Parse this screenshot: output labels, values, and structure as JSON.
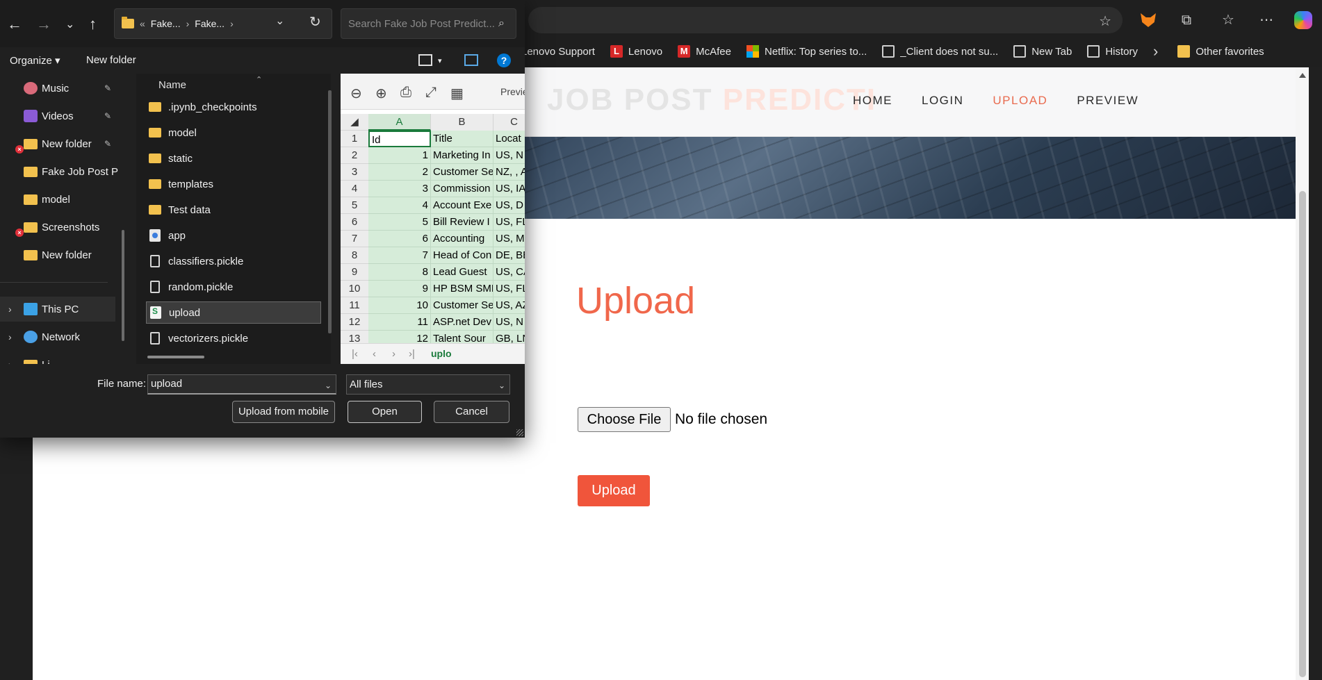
{
  "browser": {
    "bookmarks": [
      {
        "label": "Lenovo Support",
        "icon": "lenovo-icon"
      },
      {
        "label": "Lenovo",
        "icon": "lenovo-l-icon"
      },
      {
        "label": "McAfee",
        "icon": "mcafee-icon"
      },
      {
        "label": "Netflix: Top series to...",
        "icon": "microsoft-icon"
      },
      {
        "label": "_Client does not su...",
        "icon": "document-icon"
      },
      {
        "label": "New Tab",
        "icon": "document-icon"
      },
      {
        "label": "History",
        "icon": "document-icon"
      }
    ],
    "other_favorites": "Other favorites"
  },
  "site": {
    "logo_part1": "JOB POST",
    "logo_part2": "PREDICTI",
    "nav": [
      "HOME",
      "LOGIN",
      "UPLOAD",
      "PREVIEW"
    ],
    "active_nav": "UPLOAD",
    "upload_title": "Upload",
    "choose_file": "Choose File",
    "no_file": "No file chosen",
    "upload_button": "Upload",
    "accent_color": "#f0553b"
  },
  "dialog": {
    "path": [
      "Fake...",
      "Fake..."
    ],
    "path_prefix": "«",
    "search_placeholder": "Search Fake Job Post Predict...",
    "organize": "Organize ▾",
    "new_folder": "New folder",
    "sidebar": [
      {
        "label": "Music",
        "pinned": true
      },
      {
        "label": "Videos",
        "pinned": true
      },
      {
        "label": "New folder",
        "pinned": true
      },
      {
        "label": "Fake Job Post Pr",
        "pinned": false
      },
      {
        "label": "model",
        "pinned": false
      },
      {
        "label": "Screenshots",
        "pinned": false
      },
      {
        "label": "New folder",
        "pinned": false
      }
    ],
    "this_pc": "This PC",
    "network": "Network",
    "linux": "Li",
    "column_name": "Name",
    "files": [
      {
        "name": ".ipynb_checkpoints",
        "type": "folder"
      },
      {
        "name": "model",
        "type": "folder"
      },
      {
        "name": "static",
        "type": "folder"
      },
      {
        "name": "templates",
        "type": "folder"
      },
      {
        "name": "Test data",
        "type": "folder"
      },
      {
        "name": "app",
        "type": "app"
      },
      {
        "name": "classifiers.pickle",
        "type": "file"
      },
      {
        "name": "random.pickle",
        "type": "file"
      },
      {
        "name": "upload",
        "type": "xls"
      },
      {
        "name": "vectorizers.pickle",
        "type": "file"
      }
    ],
    "selected_file": "upload",
    "preview_label": "Previe",
    "sheet": {
      "columns": [
        "A",
        "B",
        "C"
      ],
      "rows": [
        [
          "1",
          "Id",
          "Title",
          "Locat"
        ],
        [
          "2",
          "1",
          "Marketing In",
          "US, N"
        ],
        [
          "3",
          "2",
          "Customer Se",
          "NZ, , A"
        ],
        [
          "4",
          "3",
          "Commission",
          "US, IA"
        ],
        [
          "5",
          "4",
          "Account Exe",
          "US, D"
        ],
        [
          "6",
          "5",
          "Bill Review I",
          "US, FL"
        ],
        [
          "7",
          "6",
          "Accounting",
          "US, M"
        ],
        [
          "8",
          "7",
          "Head of Con",
          "DE, BE"
        ],
        [
          "9",
          "8",
          "Lead Guest",
          "US, CA"
        ],
        [
          "10",
          "9",
          "HP BSM SME",
          "US, FL"
        ],
        [
          "11",
          "10",
          "Customer Se",
          "US, AZ"
        ],
        [
          "12",
          "11",
          "ASP.net Dev",
          "US, N"
        ],
        [
          "13",
          "12",
          "Talent Sour",
          "GB, LN"
        ]
      ],
      "tab": "uplo"
    },
    "file_name_label": "File name:",
    "file_name_value": "upload",
    "file_type": "All files",
    "btn_mobile": "Upload from mobile",
    "btn_open": "Open",
    "btn_cancel": "Cancel"
  }
}
